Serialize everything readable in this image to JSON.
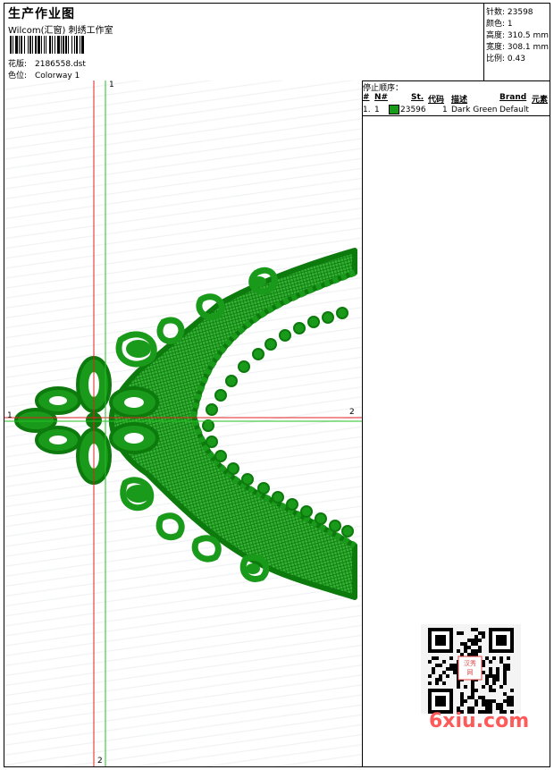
{
  "header": {
    "title": "生产作业图",
    "company": "Wilcom(汇窗) 刺绣工作室",
    "design_label": "花版:",
    "design_value": "2186558.dst",
    "colorway_label": "色位:",
    "colorway_value": "Colorway 1"
  },
  "stats": {
    "stitches": "针数: 23598",
    "colors": "颜色: 1",
    "height": "高度: 310.5 mm",
    "width": "宽度: 308.1 mm",
    "scale": "比例: 0.43"
  },
  "stop_sequence": {
    "title": "停止顺序：",
    "columns": [
      "#",
      "N#",
      "St.",
      "代码",
      "描述",
      "Brand",
      "元素"
    ],
    "rows": [
      {
        "index": "1.",
        "needle": "1",
        "stitches": "23596",
        "code": "1",
        "description": "Dark Green",
        "brand": "Default",
        "element": "",
        "color": "#1a9a1a"
      }
    ]
  },
  "axis_labels": {
    "green_top": "1",
    "green_left": "1",
    "red_right": "2",
    "red_bottom": "2"
  },
  "watermark": "6xiu.com",
  "qr_stamp": "汉秀网",
  "colors": {
    "thread": "#1a9a1a",
    "thread_dark": "#0d7a0d",
    "red_axis": "#e02020",
    "green_axis": "#22c022"
  }
}
